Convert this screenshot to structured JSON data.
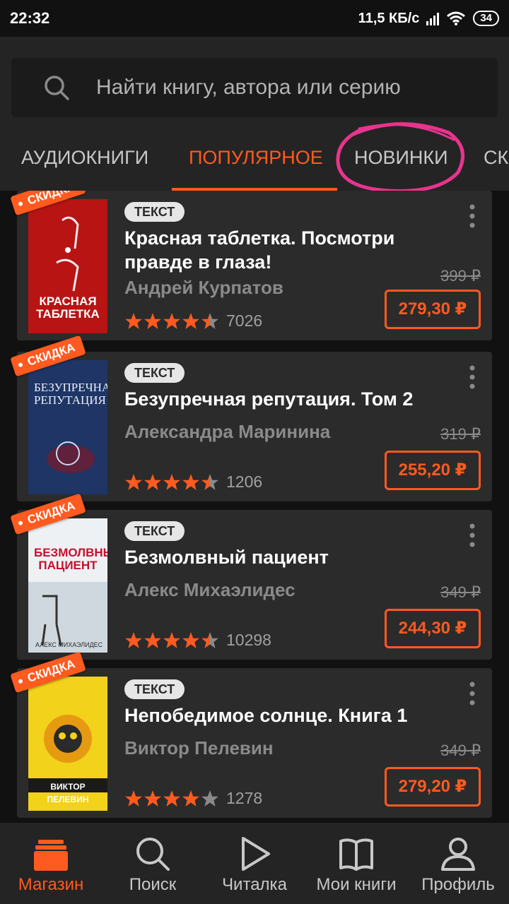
{
  "status_bar": {
    "time": "22:32",
    "network_speed": "11,5 КБ/с",
    "battery": "34"
  },
  "search": {
    "placeholder": "Найти книгу, автора или серию"
  },
  "tabs": [
    {
      "label": "АУДИОКНИГИ"
    },
    {
      "label": "ПОПУЛЯРНОЕ",
      "active": true
    },
    {
      "label": "НОВИНКИ"
    },
    {
      "label": "СК"
    }
  ],
  "books": [
    {
      "badge": "СКИДКА",
      "type": "ТЕКСТ",
      "title": "Красная таблетка. Посмотри правде в глаза!",
      "author": "Андрей Курпатов",
      "rating": 4.5,
      "rating_count": "7026",
      "old_price": "399 ₽",
      "price": "279,30 ₽",
      "cover_title": "КРАСНАЯ ТАБЛЕТКА"
    },
    {
      "badge": "СКИДКА",
      "type": "ТЕКСТ",
      "title": "Безупречная репутация. Том 2",
      "author": "Александра Маринина",
      "rating": 4.5,
      "rating_count": "1206",
      "old_price": "319 ₽",
      "price": "255,20 ₽",
      "cover_title": "БЕЗУПРЕЧНАЯ РЕПУТАЦИЯ"
    },
    {
      "badge": "СКИДКА",
      "type": "ТЕКСТ",
      "title": "Безмолвный пациент",
      "author": "Алекс Михаэлидес",
      "rating": 4.5,
      "rating_count": "10298",
      "old_price": "349 ₽",
      "price": "244,30 ₽",
      "cover_title": "БЕЗМОЛВНЫЙ ПАЦИЕНТ"
    },
    {
      "badge": "СКИДКА",
      "type": "ТЕКСТ",
      "title": "Непобедимое солнце. Книга 1",
      "author": "Виктор Пелевин",
      "rating": 4.0,
      "rating_count": "1278",
      "old_price": "349 ₽",
      "price": "279,20 ₽",
      "cover_title": "ВИКТОР ПЕЛЕВИН"
    }
  ],
  "bottom_nav": [
    {
      "label": "Магазин",
      "icon": "store-icon",
      "active": true
    },
    {
      "label": "Поиск",
      "icon": "search-icon"
    },
    {
      "label": "Читалка",
      "icon": "play-icon"
    },
    {
      "label": "Мои книги",
      "icon": "book-icon"
    },
    {
      "label": "Профиль",
      "icon": "profile-icon"
    }
  ],
  "colors": {
    "accent": "#ff5a1f",
    "background": "#111111",
    "card": "#2b2b2b",
    "annotation": "#e8348c"
  }
}
